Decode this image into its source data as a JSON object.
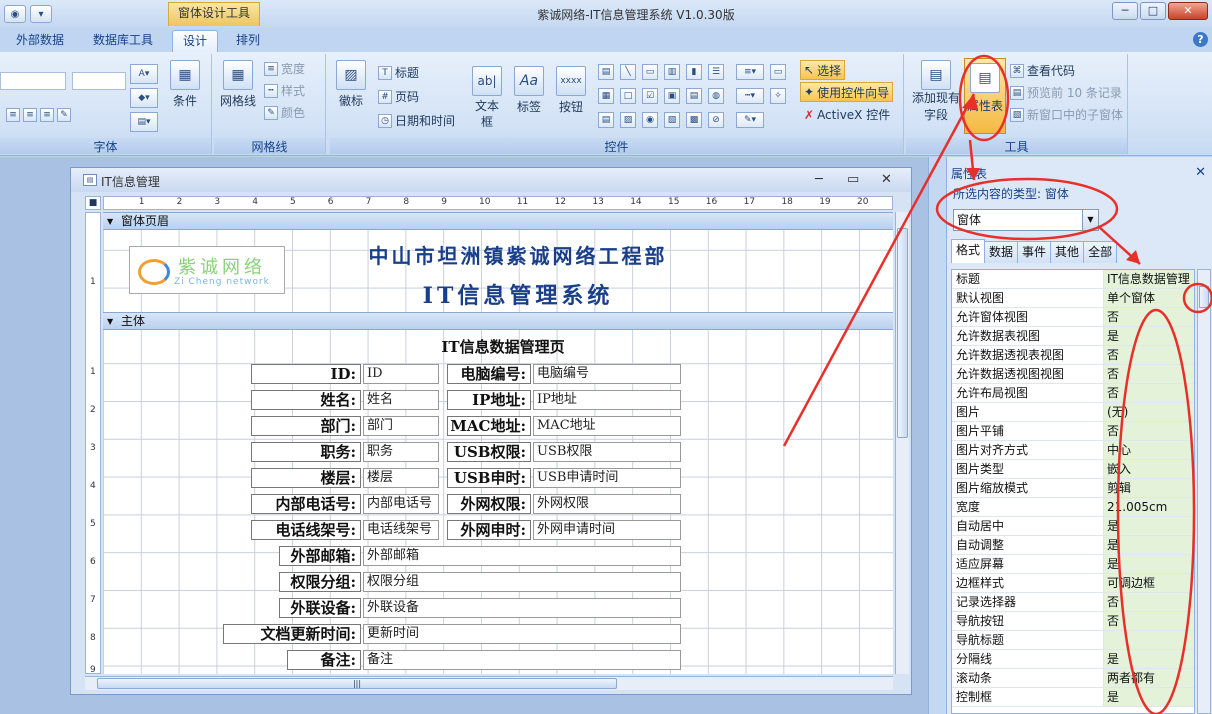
{
  "window": {
    "title": "紫诚网络-IT信息管理系统 V1.0.30版",
    "context_tab": "窗体设计工具",
    "controls": [
      "─",
      "□",
      "✕"
    ]
  },
  "ribbon_tabs": [
    {
      "label": "外部数据"
    },
    {
      "label": "数据库工具"
    },
    {
      "label": "设计",
      "active": true
    },
    {
      "label": "排列"
    }
  ],
  "ribbon": {
    "font_group": {
      "label": "字体",
      "condition": "条件"
    },
    "grid_group": {
      "label": "网格线",
      "gridlines": "网格线",
      "width": "宽度",
      "style": "样式",
      "color": "颜色"
    },
    "controls_group": {
      "label": "控件",
      "logo": "徽标",
      "title": "标题",
      "page_number": "页码",
      "date_time": "日期和时间",
      "textbox": "文本框",
      "label_ctrl": "标签",
      "button": "按钮",
      "select": "选择",
      "use_wizard": "使用控件向导",
      "activex": "ActiveX 控件"
    },
    "tools_group": {
      "label": "工具",
      "add_fields": "添加现有字段",
      "property_sheet": "属性表",
      "view_code": "查看代码",
      "preview_records": "预览前 10 条记录",
      "subform_new_window": "新窗口中的子窗体"
    }
  },
  "form_window": {
    "title": "IT信息管理",
    "ruler_marks": [
      "1",
      "2",
      "3",
      "4",
      "5",
      "6",
      "7",
      "8",
      "9",
      "10",
      "11",
      "12",
      "13",
      "14",
      "15",
      "16",
      "17",
      "18",
      "19",
      "20"
    ],
    "vruler_marks": [
      "1",
      "1",
      "2",
      "3",
      "4",
      "5",
      "6",
      "7",
      "8",
      "9"
    ],
    "header_section": "窗体页眉",
    "detail_section": "主体",
    "header_line1": "中山市坦洲镇紫诚网络工程部",
    "header_line2": "IT信息管理系统",
    "logo_cn": "紫诚网络",
    "logo_en": "Zi Cheng network",
    "page_title": "IT信息数据管理页",
    "left_fields": [
      {
        "label": "ID:",
        "value": "ID"
      },
      {
        "label": "姓名:",
        "value": "姓名"
      },
      {
        "label": "部门:",
        "value": "部门"
      },
      {
        "label": "职务:",
        "value": "职务"
      },
      {
        "label": "楼层:",
        "value": "楼层"
      },
      {
        "label": "内部电话号:",
        "value": "内部电话号"
      },
      {
        "label": "电话线架号:",
        "value": "电话线架号"
      }
    ],
    "right_fields": [
      {
        "label": "电脑编号:",
        "value": "电脑编号"
      },
      {
        "label": "IP地址:",
        "value": "IP地址"
      },
      {
        "label": "MAC地址:",
        "value": "MAC地址"
      },
      {
        "label": "USB权限:",
        "value": "USB权限"
      },
      {
        "label": "USB申时:",
        "value": "USB申请时间"
      },
      {
        "label": "外网权限:",
        "value": "外网权限"
      },
      {
        "label": "外网申时:",
        "value": "外网申请时间"
      }
    ],
    "wide_fields": [
      {
        "label": "外部邮箱:",
        "value": "外部邮箱"
      },
      {
        "label": "权限分组:",
        "value": "权限分组"
      },
      {
        "label": "外联设备:",
        "value": "外联设备"
      },
      {
        "label": "文档更新时间:",
        "value": "更新时间"
      },
      {
        "label": "备注:",
        "value": "备注"
      }
    ]
  },
  "property_sheet": {
    "title": "属性表",
    "selection_type": "所选内容的类型: 窗体",
    "selected_object": "窗体",
    "tabs": [
      "格式",
      "数据",
      "事件",
      "其他",
      "全部"
    ],
    "active_tab": "格式",
    "rows": [
      {
        "name": "标题",
        "value": "IT信息数据管理"
      },
      {
        "name": "默认视图",
        "value": "单个窗体"
      },
      {
        "name": "允许窗体视图",
        "value": "否"
      },
      {
        "name": "允许数据表视图",
        "value": "是"
      },
      {
        "name": "允许数据透视表视图",
        "value": "否"
      },
      {
        "name": "允许数据透视图视图",
        "value": "否"
      },
      {
        "name": "允许布局视图",
        "value": "否"
      },
      {
        "name": "图片",
        "value": "(无)"
      },
      {
        "name": "图片平铺",
        "value": "否"
      },
      {
        "name": "图片对齐方式",
        "value": "中心"
      },
      {
        "name": "图片类型",
        "value": "嵌入"
      },
      {
        "name": "图片缩放模式",
        "value": "剪辑"
      },
      {
        "name": "宽度",
        "value": "21.005cm"
      },
      {
        "name": "自动居中",
        "value": "是"
      },
      {
        "name": "自动调整",
        "value": "是"
      },
      {
        "name": "适应屏幕",
        "value": "是"
      },
      {
        "name": "边框样式",
        "value": "可调边框"
      },
      {
        "name": "记录选择器",
        "value": "否"
      },
      {
        "name": "导航按钮",
        "value": "否"
      },
      {
        "name": "导航标题",
        "value": ""
      },
      {
        "name": "分隔线",
        "value": "是"
      },
      {
        "name": "滚动条",
        "value": "两者都有"
      },
      {
        "name": "控制框",
        "value": "是"
      }
    ]
  },
  "colors": {
    "annotation": "#e8302a",
    "header_text": "#1a3f8a",
    "value_cell": "#e3f2d9"
  }
}
